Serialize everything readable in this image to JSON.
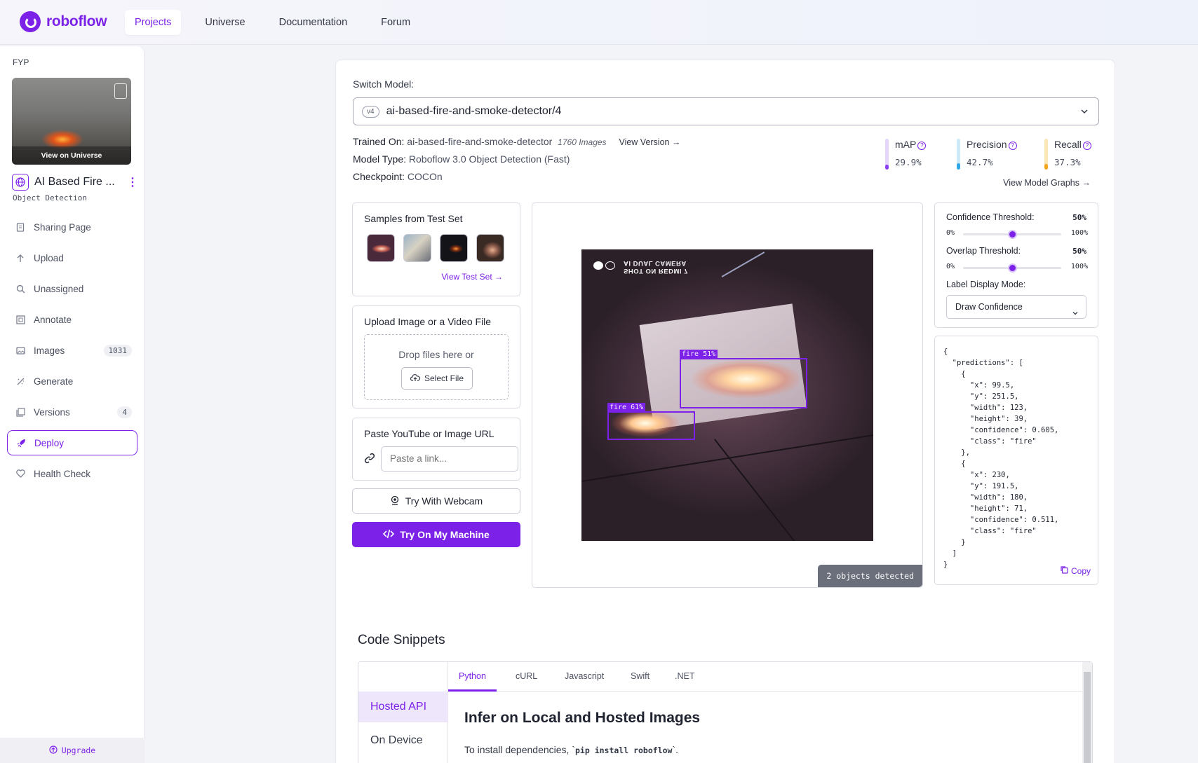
{
  "nav": {
    "brand": "roboflow",
    "links": [
      "Projects",
      "Universe",
      "Documentation",
      "Forum"
    ],
    "active": "Projects"
  },
  "sidebar": {
    "workspace": "FYP",
    "thumbnail_caption": "View on Universe",
    "project_name": "AI Based Fire ...",
    "project_type": "Object Detection",
    "items": [
      {
        "label": "Sharing Page",
        "icon": "page-icon"
      },
      {
        "label": "Upload",
        "icon": "arrow-up-icon"
      },
      {
        "label": "Unassigned",
        "icon": "search-icon"
      },
      {
        "label": "Annotate",
        "icon": "annotate-icon"
      },
      {
        "label": "Images",
        "icon": "images-icon",
        "count": "1031"
      },
      {
        "label": "Generate",
        "icon": "generate-icon"
      },
      {
        "label": "Versions",
        "icon": "versions-icon",
        "count": "4"
      },
      {
        "label": "Deploy",
        "icon": "rocket-icon",
        "active": true
      },
      {
        "label": "Health Check",
        "icon": "heart-icon"
      }
    ],
    "upgrade": "Upgrade"
  },
  "model": {
    "switch_label": "Switch Model:",
    "version_pill": "v4",
    "selected": "ai-based-fire-and-smoke-detector/4",
    "trained_on_label": "Trained On:",
    "trained_on": "ai-based-fire-and-smoke-detector",
    "images": "1760 Images",
    "view_version": "View Version",
    "model_type_label": "Model Type:",
    "model_type": "Roboflow 3.0 Object Detection (Fast)",
    "checkpoint_label": "Checkpoint:",
    "checkpoint": "COCOn"
  },
  "metrics": [
    {
      "name": "mAP",
      "value": "29.9%",
      "fraction": 0.299,
      "color": "#8b3ff0",
      "track": "#e4d6fb"
    },
    {
      "name": "Precision",
      "value": "42.7%",
      "fraction": 0.427,
      "color": "#2ea8e8",
      "track": "#cdeaf9"
    },
    {
      "name": "Recall",
      "value": "37.3%",
      "fraction": 0.373,
      "color": "#f2a61c",
      "track": "#fbe6b6"
    }
  ],
  "view_model_graphs": "View Model Graphs",
  "samples": {
    "title": "Samples from Test Set",
    "link": "View Test Set"
  },
  "upload": {
    "title": "Upload Image or a Video File",
    "drop_text": "Drop files here or",
    "select_file": "Select File"
  },
  "url": {
    "title": "Paste YouTube or Image URL",
    "placeholder": "Paste a link..."
  },
  "buttons": {
    "webcam": "Try With Webcam",
    "machine": "Try On My Machine"
  },
  "viewer": {
    "overlay_text": "SHOT ON REDMI 7\nAI DUAL CAMERA",
    "detections": [
      {
        "label": "fire 51%"
      },
      {
        "label": "fire 61%"
      }
    ],
    "detected_text": "2 objects detected"
  },
  "controls": {
    "confidence_label": "Confidence Threshold:",
    "confidence_value": "50%",
    "confidence_fraction": 0.5,
    "overlap_label": "Overlap Threshold:",
    "overlap_value": "50%",
    "overlap_fraction": 0.5,
    "min": "0%",
    "max": "100%",
    "label_mode_label": "Label Display Mode:",
    "label_mode": "Draw Confidence"
  },
  "json_output": "{\n  \"predictions\": [\n    {\n      \"x\": 99.5,\n      \"y\": 251.5,\n      \"width\": 123,\n      \"height\": 39,\n      \"confidence\": 0.605,\n      \"class\": \"fire\"\n    },\n    {\n      \"x\": 230,\n      \"y\": 191.5,\n      \"width\": 180,\n      \"height\": 71,\n      \"confidence\": 0.511,\n      \"class\": \"fire\"\n    }\n  ]\n}",
  "copy_label": "Copy",
  "snippets": {
    "title": "Code Snippets",
    "side": [
      "Hosted API",
      "On Device"
    ],
    "tabs": [
      "Python",
      "cURL",
      "Javascript",
      "Swift",
      ".NET"
    ],
    "section_title": "Infer on Local and Hosted Images",
    "install_prefix": "To install dependencies, `",
    "install_code": "pip install roboflow",
    "install_suffix": "`."
  }
}
